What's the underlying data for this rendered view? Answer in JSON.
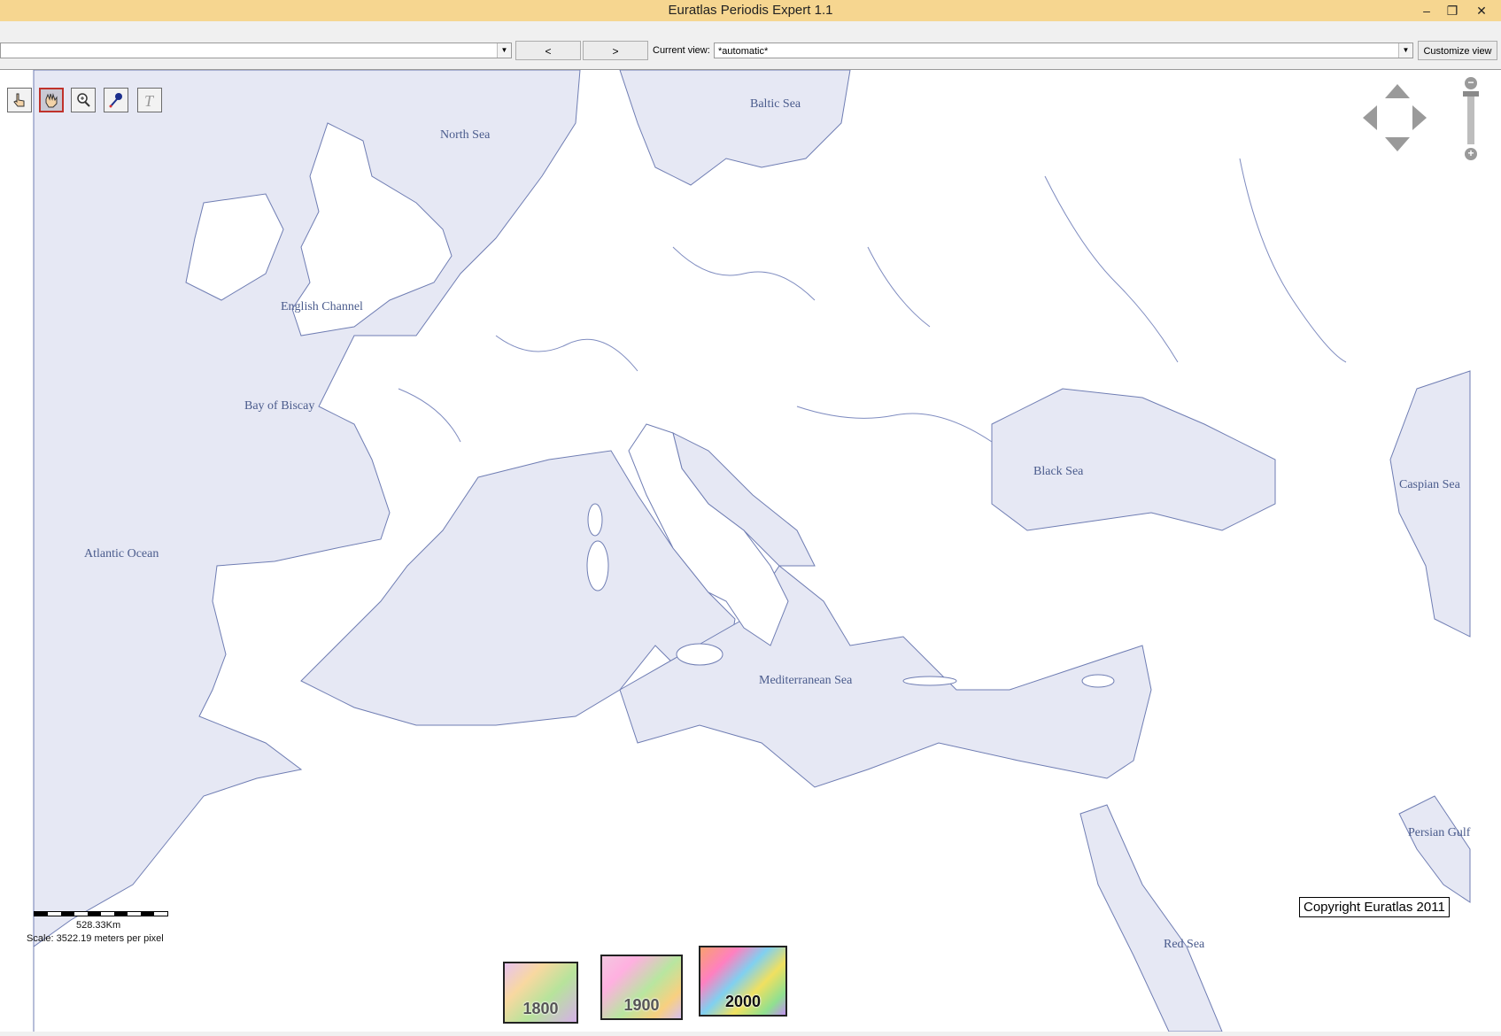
{
  "window": {
    "title": "Euratlas Periodis Expert 1.1",
    "minimize": "–",
    "restore": "❐",
    "close": "✕"
  },
  "toolbar": {
    "left_combo_value": "",
    "prev_label": "<",
    "next_label": ">",
    "current_view_label": "Current view:",
    "current_view_value": "*automatic*",
    "customize_label": "Customize view"
  },
  "map": {
    "sea_labels": {
      "north_sea": "North Sea",
      "baltic_sea": "Baltic Sea",
      "english_channel": "English Channel",
      "bay_of_biscay": "Bay of Biscay",
      "atlantic_ocean": "Atlantic Ocean",
      "black_sea": "Black Sea",
      "caspian_sea": "Caspian Sea",
      "mediterranean_sea": "Mediterranean Sea",
      "persian_gulf": "Persian Gulf",
      "red_sea": "Red Sea"
    },
    "colors": {
      "sea": "#e6e8f4",
      "land": "#ffffff",
      "coast": "#6f7db3"
    }
  },
  "tools": [
    "pointer-hand-icon",
    "pan-hand-icon",
    "zoom-magnifier-icon",
    "pin-icon",
    "text-icon"
  ],
  "navigation": {
    "zoom_out": "−",
    "zoom_in": "+"
  },
  "years": {
    "y1800": "1800",
    "y1900": "1900",
    "y2000": "2000"
  },
  "scale": {
    "distance": "528.33Km",
    "scale_text": "Scale: 3522.19 meters per pixel"
  },
  "copyright": "Copyright Euratlas 2011"
}
